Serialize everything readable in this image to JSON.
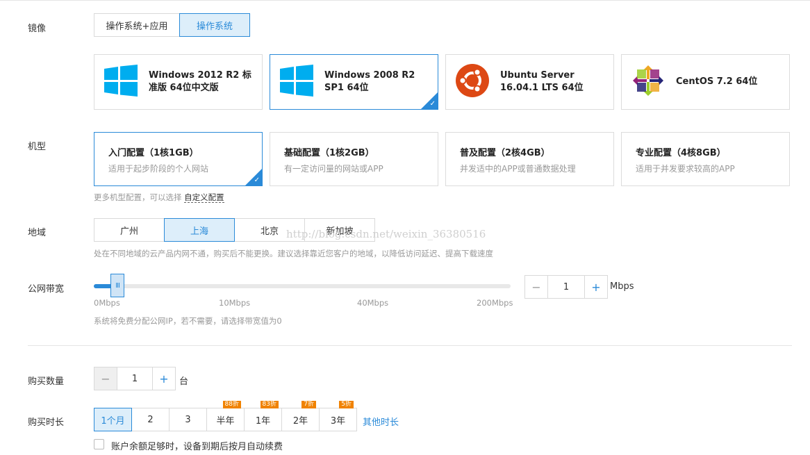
{
  "image": {
    "label": "镜像",
    "tabs": [
      {
        "label": "操作系统+应用",
        "active": false
      },
      {
        "label": "操作系统",
        "active": true
      }
    ],
    "os_options": [
      {
        "title": "Windows 2012 R2 标准版 64位中文版",
        "icon": "windows-icon",
        "active": false
      },
      {
        "title": "Windows 2008 R2 SP1 64位",
        "icon": "windows-icon",
        "active": true
      },
      {
        "title": "Ubuntu Server 16.04.1 LTS 64位",
        "icon": "ubuntu-icon",
        "active": false
      },
      {
        "title": "CentOS 7.2 64位",
        "icon": "centos-icon",
        "active": false
      }
    ]
  },
  "instance": {
    "label": "机型",
    "options": [
      {
        "title": "入门配置（1核1GB）",
        "desc": "适用于起步阶段的个人网站",
        "active": true
      },
      {
        "title": "基础配置（1核2GB）",
        "desc": "有一定访问量的网站或APP",
        "active": false
      },
      {
        "title": "普及配置（2核4GB）",
        "desc": "并发适中的APP或普通数据处理",
        "active": false
      },
      {
        "title": "专业配置（4核8GB）",
        "desc": "适用于并发要求较高的APP",
        "active": false
      }
    ],
    "hint_prefix": "更多机型配置，可以选择",
    "hint_link": "自定义配置"
  },
  "region": {
    "label": "地域",
    "options": [
      {
        "label": "广州",
        "active": false
      },
      {
        "label": "上海",
        "active": true
      },
      {
        "label": "北京",
        "active": false
      },
      {
        "label": "新加坡",
        "active": false
      }
    ],
    "hint": "处在不同地域的云产品内网不通，购买后不能更换。建议选择靠近您客户的地域，以降低访问延迟、提高下载速度"
  },
  "bandwidth": {
    "label": "公网带宽",
    "ticks": [
      "0Mbps",
      "10Mbps",
      "40Mbps",
      "200Mbps"
    ],
    "value": "1",
    "value_fraction": 0.045,
    "knob_glyph": "III",
    "minus": "−",
    "plus": "+",
    "unit": "Mbps",
    "hint": "系统将免费分配公网IP，若不需要，请选择带宽值为0"
  },
  "quantity": {
    "label": "购买数量",
    "minus": "−",
    "value": "1",
    "plus": "+",
    "unit": "台"
  },
  "duration": {
    "label": "购买时长",
    "options": [
      {
        "label": "1个月",
        "active": true,
        "badge": ""
      },
      {
        "label": "2",
        "active": false,
        "badge": ""
      },
      {
        "label": "3",
        "active": false,
        "badge": ""
      },
      {
        "label": "半年",
        "active": false,
        "badge": "88折"
      },
      {
        "label": "1年",
        "active": false,
        "badge": "83折"
      },
      {
        "label": "2年",
        "active": false,
        "badge": "7折"
      },
      {
        "label": "3年",
        "active": false,
        "badge": "5折"
      }
    ],
    "other_link": "其他时长",
    "auto_renew_label": "账户余额足够时，设备到期后按月自动续费"
  },
  "watermark": "http://blog.csdn.net/weixin_36380516",
  "colors": {
    "accent": "#2a8ad8",
    "badge": "#f08200",
    "windows": "#00adef",
    "ubuntu": "#dd4814"
  }
}
